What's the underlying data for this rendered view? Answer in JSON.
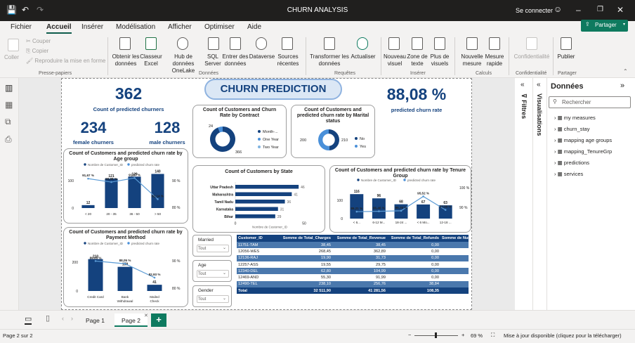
{
  "window": {
    "title": "CHURN ANALYSIS",
    "sign_in": "Se connecter"
  },
  "menu": {
    "items": [
      "Fichier",
      "Accueil",
      "Insérer",
      "Modélisation",
      "Afficher",
      "Optimiser",
      "Aide"
    ],
    "active": "Accueil",
    "share": "Partager"
  },
  "ribbon": {
    "clipboard": {
      "paste": "Coller",
      "cut": "Couper",
      "copy": "Copier",
      "format_painter": "Reproduire la mise en forme",
      "group": "Presse-papiers"
    },
    "data": {
      "get_data": "Obtenir les données",
      "excel": "Classeur Excel",
      "onelake": "Hub de données OneLake",
      "sql": "SQL Server",
      "enter": "Entrer des données",
      "dataverse": "Dataverse",
      "recent": "Sources récentes",
      "group": "Données"
    },
    "queries": {
      "transform": "Transformer les données",
      "refresh": "Actualiser",
      "group": "Requêtes"
    },
    "insert": {
      "visual": "Nouveau visuel",
      "textbox": "Zone de texte",
      "more": "Plus de visuels",
      "group": "Insérer"
    },
    "calc": {
      "measure": "Nouvelle mesure",
      "quick": "Mesure rapide",
      "group": "Calculs"
    },
    "sens": {
      "label": "Confidentialité",
      "group": "Confidentialité"
    },
    "share": {
      "publish": "Publier",
      "group": "Partager"
    }
  },
  "report": {
    "banner": "CHURN PREDICTION",
    "kpis": {
      "predicted_churners": {
        "value": "362",
        "label": "Count of predicted churners"
      },
      "female": {
        "value": "234",
        "label": "female churners"
      },
      "male": {
        "value": "128",
        "label": "male churners"
      },
      "rate": {
        "value": "88,08 %",
        "label": "predicted churn rate"
      }
    },
    "contract_donut": {
      "title": "Count of Customers and Churn Rate by Contract",
      "labels": [
        "24",
        "366"
      ],
      "legend": [
        "Month-...",
        "One Year",
        "Two Year"
      ]
    },
    "marital_donut": {
      "title": "Count of Customers and predicted churn rate by Marital status",
      "labels": [
        "200",
        "210"
      ],
      "legend": [
        "No",
        "Yes"
      ]
    },
    "state_bar": {
      "title": "Count of Customers by State",
      "axis_label": "Nombre de Customer_ID",
      "ticks": [
        "0",
        "50"
      ]
    },
    "age_combo": {
      "title": "Count of Customers and predicted churn rate by Age group",
      "legend": [
        "Nombre de Customer_ID",
        "predicted churn rate"
      ],
      "left_ticks": [
        "100",
        "0"
      ],
      "right_ticks": [
        "90 %",
        "80 %"
      ]
    },
    "tenure_combo": {
      "title": "Count of Customers and predicted churn rate by Tenure Group",
      "legend": [
        "Nombre de Customer_ID",
        "predicted churn rate"
      ],
      "left_ticks": [
        "100",
        "0"
      ],
      "right_ticks": [
        "100 %",
        "90 %"
      ]
    },
    "payment_combo": {
      "title": "Count of Customers and predicted churn rate by Payment Method",
      "legend": [
        "Nombre de Customer_ID",
        "predicted churn rate"
      ],
      "left_ticks": [
        "200",
        "0"
      ],
      "right_ticks": [
        "90 %",
        "80 %"
      ]
    },
    "slicers": [
      {
        "label": "Married",
        "value": "Tout"
      },
      {
        "label": "Age",
        "value": "Tout"
      },
      {
        "label": "Gender",
        "value": "Tout"
      }
    ],
    "table": {
      "headers": [
        "Customer_ID",
        "Somme de Total_Charges",
        "Somme de Total_Revenue",
        "Somme de Total_Refunds",
        "Somme de Number"
      ],
      "rows": [
        [
          "11751-TAM",
          "38,45",
          "38,45",
          "0,00",
          ""
        ],
        [
          "12056-WES",
          "268,45",
          "362,89",
          "0,00",
          ""
        ],
        [
          "12136-RAJ",
          "19,90",
          "31,73",
          "0,00",
          ""
        ],
        [
          "12257-ASS",
          "19,55",
          "29,75",
          "0,00",
          ""
        ],
        [
          "12340-DEL",
          "62,80",
          "104,99",
          "0,00",
          ""
        ],
        [
          "12469-AND",
          "55,30",
          "91,99",
          "0,00",
          ""
        ],
        [
          "12490-TEL",
          "238,10",
          "256,76",
          "38,84",
          ""
        ]
      ],
      "total": [
        "Total",
        "32 511,90",
        "41 281,56",
        "108,35",
        ""
      ]
    }
  },
  "chart_data": [
    {
      "type": "pie",
      "title": "Count of Customers and Churn Rate by Contract",
      "categories": [
        "Month-...",
        "One Year",
        "Two Year"
      ],
      "values": [
        366,
        24,
        0
      ],
      "colors": [
        "#14427e",
        "#4a90d9",
        "#7fb3e0"
      ]
    },
    {
      "type": "pie",
      "title": "Count of Customers and predicted churn rate by Marital status",
      "categories": [
        "No",
        "Yes"
      ],
      "values": [
        200,
        210
      ],
      "colors": [
        "#14427e",
        "#4a90d9"
      ]
    },
    {
      "type": "bar",
      "title": "Count of Customers by State",
      "categories": [
        "Uttar Pradesh",
        "Maharashtra",
        "Tamil Nadu",
        "Karnataka",
        "Bihar"
      ],
      "values": [
        46,
        41,
        36,
        31,
        29
      ],
      "xlabel": "Nombre de Customer_ID",
      "xlim": [
        0,
        50
      ],
      "color": "#14427e"
    },
    {
      "type": "bar",
      "title": "Count of Customers and predicted churn rate by Age group",
      "categories": [
        "< 20",
        "20 - 35",
        "36 - 50",
        "> 50"
      ],
      "series": [
        {
          "name": "Nombre de Customer_ID",
          "values": [
            12,
            121,
            129,
            140
          ]
        },
        {
          "name": "predicted churn rate",
          "values": [
            91.67,
            90.08,
            91.97,
            82.14
          ]
        }
      ],
      "value_labels": [
        "12",
        "121",
        "129",
        "140"
      ],
      "rate_labels": [
        "91,67 %",
        "90,08 %",
        "91,97 %",
        "82,14 %"
      ],
      "ylim": [
        0,
        150
      ],
      "y2lim": [
        78,
        95
      ]
    },
    {
      "type": "bar",
      "title": "Count of Customers and predicted churn rate by Tenure Group",
      "categories": [
        "< 6...",
        "6-12 M...",
        "18-24 ...",
        "< 6 Mo...",
        "12-18 ..."
      ],
      "series": [
        {
          "name": "Nombre de Customer_ID",
          "values": [
            116,
            96,
            68,
            67,
            63
          ]
        },
        {
          "name": "predicted churn rate",
          "values": [
            86.21,
            86.46,
            86.76,
            95.52,
            87.3
          ]
        }
      ],
      "value_labels": [
        "116",
        "96",
        "68",
        "67",
        "63"
      ],
      "rate_labels": [
        "86,21 %",
        "86,46 %",
        "86,76 %",
        "95,52 %",
        "87,30 %"
      ],
      "ylim": [
        0,
        140
      ],
      "y2lim": [
        82,
        100
      ]
    },
    {
      "type": "bar",
      "title": "Count of Customers and predicted churn rate by Payment Method",
      "categories": [
        "Credit Card",
        "Bank Withdrawal",
        "Mailed Check"
      ],
      "series": [
        {
          "name": "Nombre de Customer_ID",
          "values": [
            210,
            159,
            41
          ]
        },
        {
          "name": "predicted churn rate",
          "values": [
            89.05,
            88.05,
            82.93
          ]
        }
      ],
      "value_labels": [
        "210",
        "159",
        "41"
      ],
      "rate_labels": [
        "89,05 %",
        "88,05 %",
        "82,93 %"
      ],
      "ylim": [
        0,
        250
      ],
      "y2lim": [
        78,
        92
      ]
    }
  ],
  "side": {
    "filters": "Filtres",
    "visualizations": "Visualisations",
    "data_title": "Données",
    "search": "Rechercher",
    "items": [
      "my measures",
      "churn_stay",
      "mapping age groups",
      "mapping_TenureGrp",
      "predictions",
      "services"
    ]
  },
  "pages": {
    "tabs": [
      "Page 1",
      "Page 2"
    ],
    "active": "Page 2"
  },
  "status": {
    "page": "Page 2 sur 2",
    "zoom": "69 %",
    "update": "Mise à jour disponible (cliquez pour la télécharger)"
  },
  "colors": {
    "dark_blue": "#14427e",
    "mid_blue": "#4a90d9",
    "light_blue": "#7fb3e0",
    "accent_green": "#0e7a5f"
  }
}
